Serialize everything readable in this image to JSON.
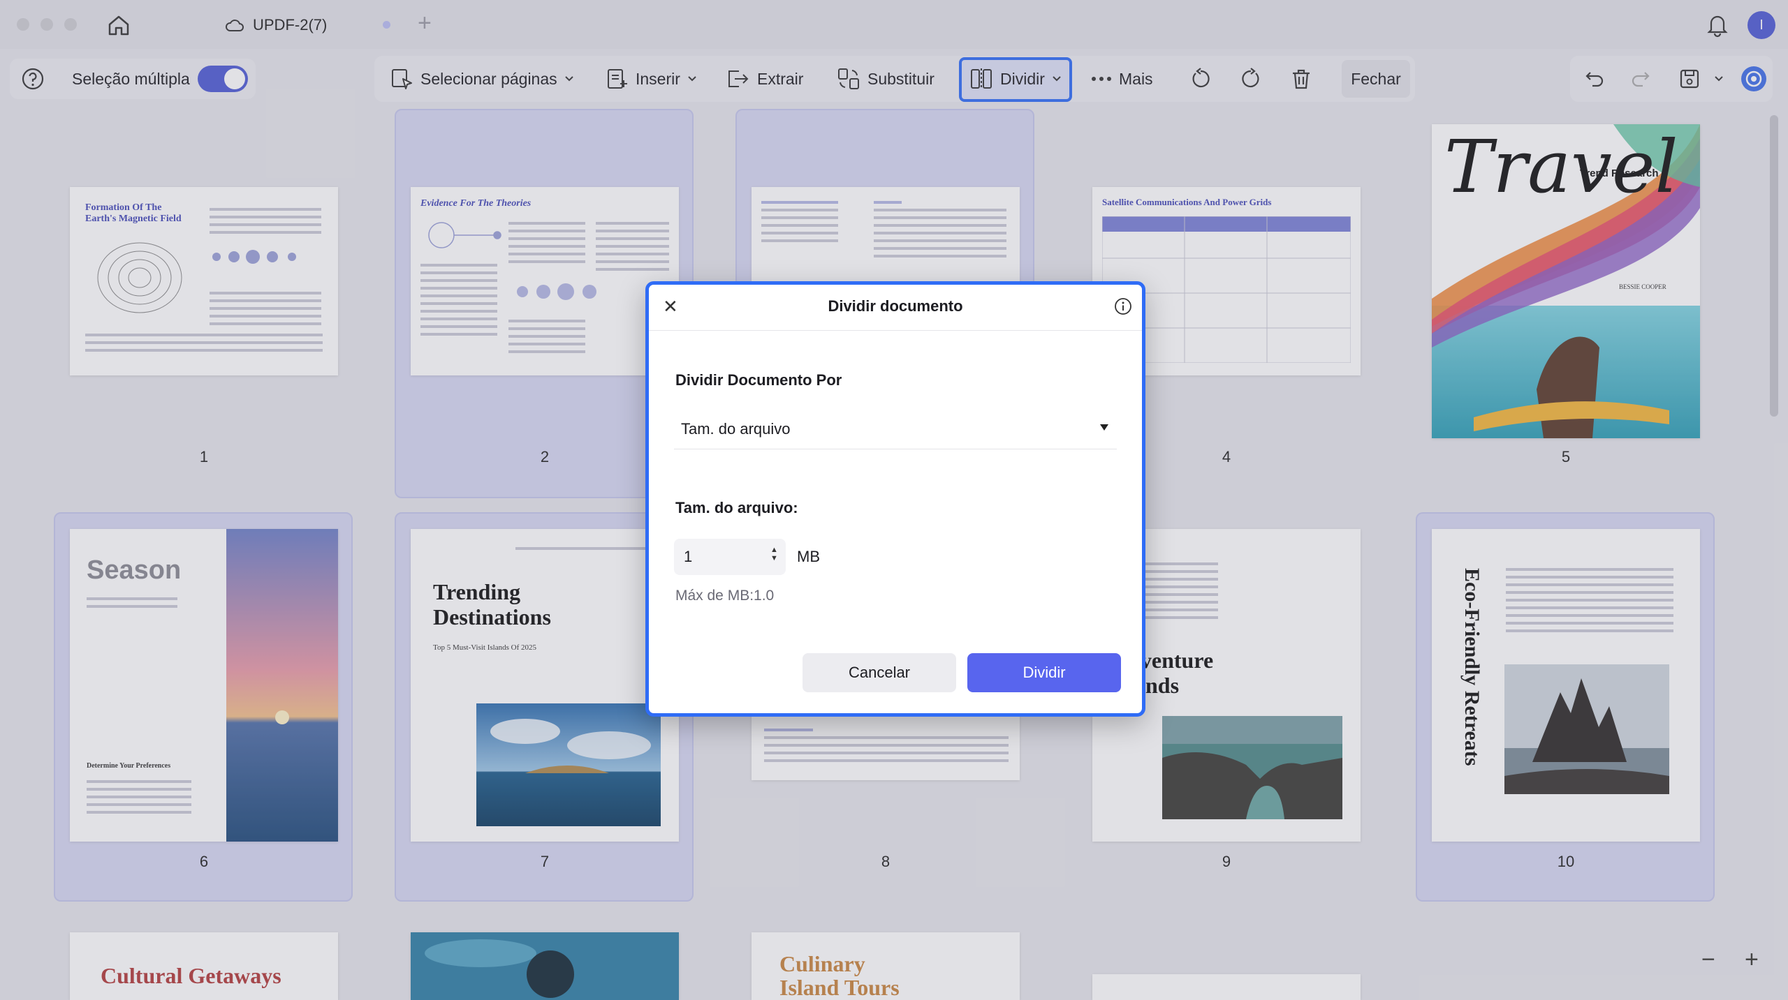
{
  "tab": {
    "title": "UPDF-2(7)"
  },
  "avatar": {
    "initial": "I"
  },
  "toolbar": {
    "multi_select_label": "Seleção múltipla",
    "select_pages": "Selecionar páginas",
    "insert": "Inserir",
    "extract": "Extrair",
    "replace": "Substituir",
    "split": "Dividir",
    "more": "Mais",
    "close": "Fechar"
  },
  "pages": [
    {
      "number": "1",
      "title": "Formation Of The Earth's Magnetic Field"
    },
    {
      "number": "2",
      "title": "Evidence For The Theories"
    },
    {
      "number": "3",
      "title": ""
    },
    {
      "number": "4",
      "title": "Satellite Communications And Power Grids"
    },
    {
      "number": "5",
      "title": "Travel",
      "subtitle": "Trend Research",
      "author": "BESSIE COOPER"
    },
    {
      "number": "6",
      "title": "Season",
      "subtitle": "Determine Your Preferences"
    },
    {
      "number": "7",
      "title": "Trending Destinations",
      "subtitle": "Top 5 Must-Visit Islands Of 2025"
    },
    {
      "number": "8",
      "title": ""
    },
    {
      "number": "9",
      "title": "lventure ands"
    },
    {
      "number": "10",
      "title": "Eco-Friendly Retreats"
    },
    {
      "number": "",
      "title": "Cultural Getaways"
    },
    {
      "number": "",
      "title": ""
    },
    {
      "number": "",
      "title": "Culinary Island Tours"
    }
  ],
  "dialog": {
    "title": "Dividir documento",
    "split_by_label": "Dividir Documento Por",
    "split_by_value": "Tam. do arquivo",
    "file_size_label": "Tam. do arquivo:",
    "file_size_value": "1",
    "unit": "MB",
    "max_label": "Máx de MB:1.0",
    "cancel": "Cancelar",
    "confirm": "Dividir"
  },
  "zoom": {
    "minus": "−",
    "plus": "+"
  },
  "colors": {
    "accent": "#5865ee",
    "focus": "#2f6cf6",
    "selected_bg": "#d7d8f2"
  }
}
